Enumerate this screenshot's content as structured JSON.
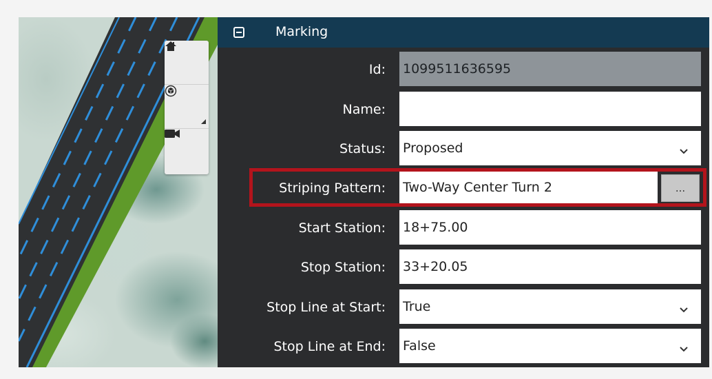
{
  "panel": {
    "title": "Marking",
    "fields": {
      "id": {
        "label": "Id:",
        "value": "1099511636595"
      },
      "name": {
        "label": "Name:",
        "value": ""
      },
      "status": {
        "label": "Status:",
        "value": "Proposed"
      },
      "striping_pattern": {
        "label": "Striping Pattern:",
        "value": "Two-Way Center Turn 2",
        "button_label": "..."
      },
      "start_station": {
        "label": "Start Station:",
        "value": "18+75.00"
      },
      "stop_station": {
        "label": "Stop Station:",
        "value": "33+20.05"
      },
      "stop_line_at_start": {
        "label": "Stop Line at Start:",
        "value": "True"
      },
      "stop_line_at_end": {
        "label": "Stop Line at End:",
        "value": "False"
      }
    }
  },
  "map_toolbar": {
    "buttons": [
      {
        "icon": "home-icon"
      },
      {
        "icon": "view-cube-icon"
      },
      {
        "icon": "camera-icon"
      }
    ]
  },
  "colors": {
    "header_bg": "#143a52",
    "panel_bg": "#2b2c2e",
    "highlight": "#b3141c",
    "lane_line": "#2f8ed9",
    "road_edge": "#5f9a2a"
  }
}
